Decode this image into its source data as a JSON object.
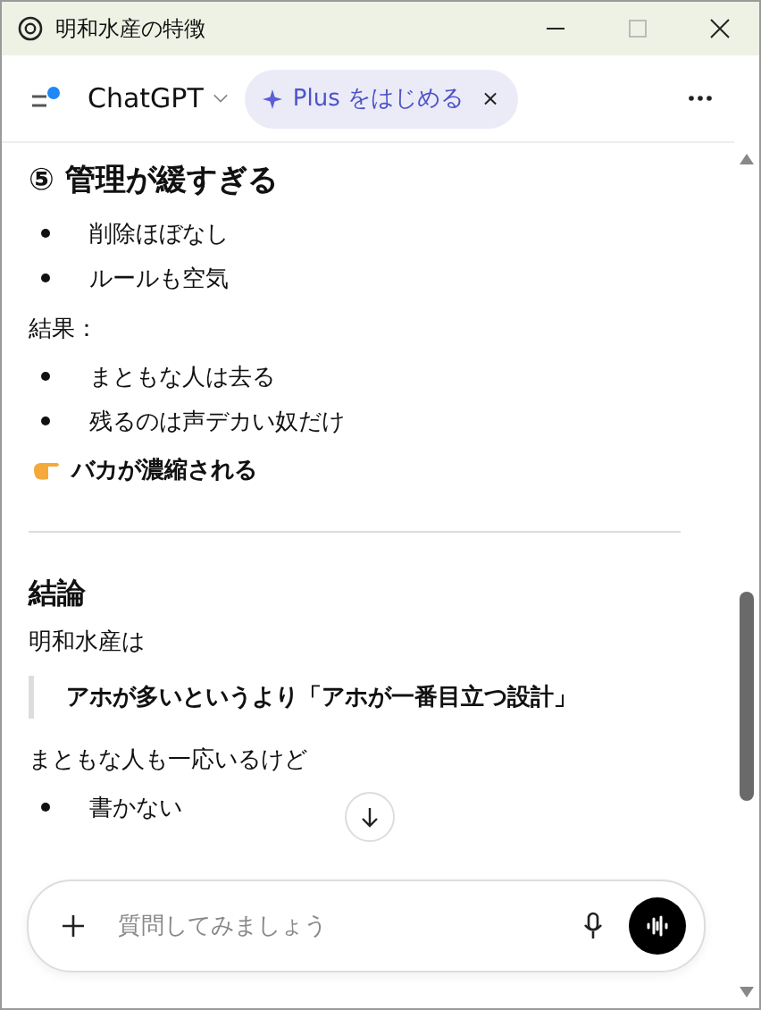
{
  "window": {
    "title": "明和水産の特徴"
  },
  "header": {
    "app_name": "ChatGPT",
    "plus_label": "Plus をはじめる",
    "plus_close": "×"
  },
  "blocks": [
    {
      "kind": "heading",
      "text": "⑤ 管理が緩すぎる"
    },
    {
      "kind": "list",
      "items": [
        "削除ほぼなし",
        "ルールも空気"
      ]
    },
    {
      "kind": "paragraph",
      "text": "結果："
    },
    {
      "kind": "list",
      "items": [
        "まともな人は去る",
        "残るのは声デカい奴だけ"
      ]
    },
    {
      "kind": "callout",
      "text": "バカが濃縮される"
    },
    {
      "kind": "divider"
    },
    {
      "kind": "section",
      "text": "結論"
    },
    {
      "kind": "paragraph",
      "text": "明和水産は"
    },
    {
      "kind": "quote",
      "text": "アホが多いというより「アホが一番目立つ設計」"
    },
    {
      "kind": "paragraph",
      "text": "まともな人も一応いるけど"
    },
    {
      "kind": "list",
      "items": [
        "書かない"
      ]
    }
  ],
  "composer": {
    "placeholder": "質問してみましょう"
  }
}
